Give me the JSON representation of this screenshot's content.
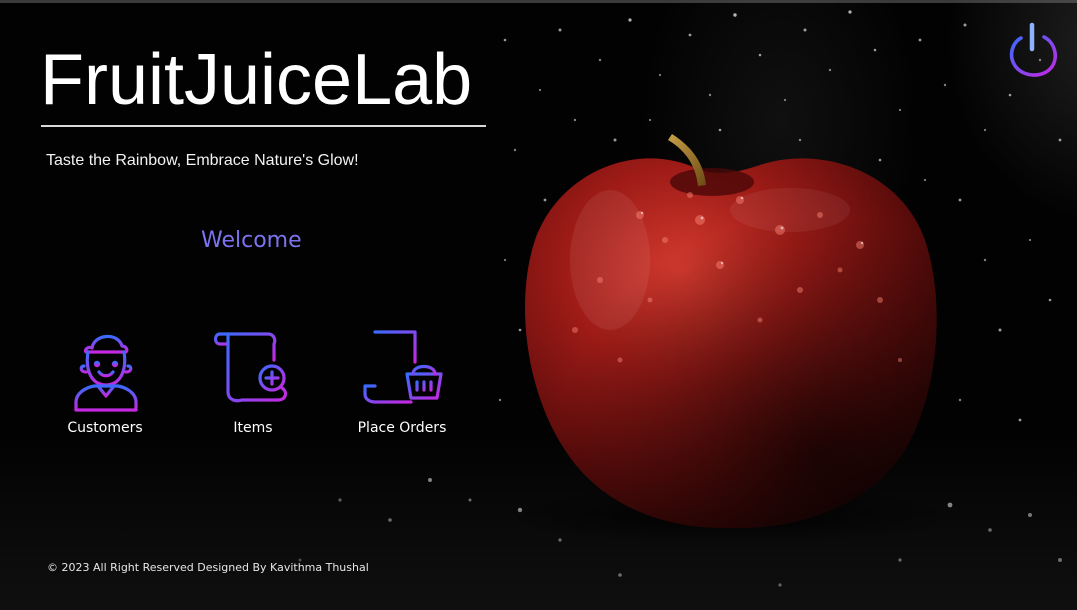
{
  "app": {
    "title": "FruitJuiceLab",
    "tagline": "Taste the Rainbow, Embrace Nature's Glow!",
    "welcome": "Welcome"
  },
  "nav": {
    "items": [
      {
        "label": "Customers",
        "icon": "customer-avatar-icon"
      },
      {
        "label": "Items",
        "icon": "scroll-document-add-icon"
      },
      {
        "label": "Place Orders",
        "icon": "order-form-basket-icon"
      }
    ]
  },
  "power": {
    "icon": "power-icon"
  },
  "footer": {
    "text": "© 2023 All Right Reserved Designed By Kavithma Thushal"
  },
  "background": {
    "image": "red-apple-with-water-droplets"
  },
  "colors": {
    "accent_purple": "#7c74ee",
    "icon_gradient_start": "#3a6bff",
    "icon_gradient_end": "#c528e0",
    "apple_red": "#8e1614",
    "background": "#020202"
  }
}
